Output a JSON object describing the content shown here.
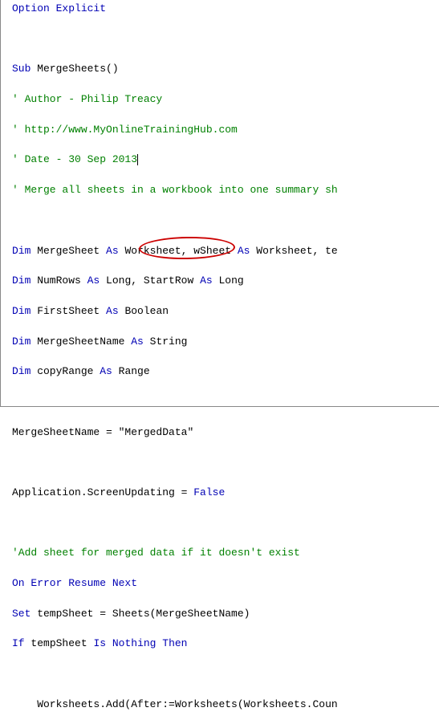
{
  "code": {
    "l1_option": "Option",
    "l1_explicit": " Explicit",
    "l3_sub": "Sub",
    "l3_name": " MergeSheets()",
    "l4": "' Author - Philip Treacy",
    "l5": "' http://www.MyOnlineTrainingHub.com",
    "l6": "' Date - 30 Sep 2013",
    "l7": "' Merge all sheets in a workbook into one summary sh",
    "l9_dim": "Dim",
    "l9_a": " MergeSheet ",
    "l9_as": "As",
    "l9_b": " Worksheet, wSheet ",
    "l9_as2": "As",
    "l9_c": " Worksheet, te",
    "l10_dim": "Dim",
    "l10_a": " NumRows ",
    "l10_as": "As",
    "l10_b": " Long, StartRow ",
    "l10_as2": "As",
    "l10_c": " Long",
    "l11_dim": "Dim",
    "l11_a": " FirstSheet ",
    "l11_as": "As",
    "l11_b": " Boolean",
    "l12_dim": "Dim",
    "l12_a": " MergeSheetName ",
    "l12_as": "As",
    "l12_b": " String",
    "l13_dim": "Dim",
    "l13_a": " copyRange ",
    "l13_as": "As",
    "l13_b": " Range",
    "l15_a": "MergeSheetName = ",
    "l15_lit": "\"MergedData\"",
    "l17_a": "Application.ScreenUpdating = ",
    "l17_false": "False",
    "l19": "'Add sheet for merged data if it doesn't exist",
    "l20_on": "On Error Resume Next",
    "l21_set": "Set",
    "l21_a": " tempSheet = Sheets(MergeSheetName)",
    "l22_if": "If",
    "l22_a": " tempSheet ",
    "l22_is": "Is",
    "l22_b": " ",
    "l22_nothing": "Nothing",
    "l22_c": " ",
    "l22_then": "Then",
    "l24_a": "    Worksheets.Add(After:=Worksheets(Worksheets.Coun"
  },
  "annotation": {
    "target": "MergedData literal"
  }
}
